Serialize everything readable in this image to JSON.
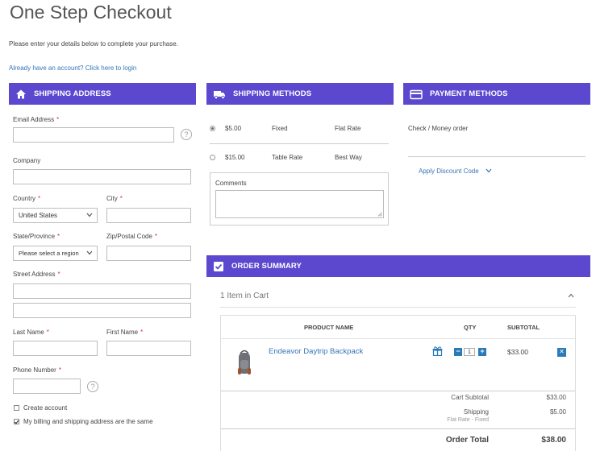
{
  "page": {
    "title": "One Step Checkout",
    "intro": "Please enter your details below to complete your purchase.",
    "login_link": "Already have an account? Click here to login"
  },
  "colors": {
    "header_bg": "#5c48cf",
    "link": "#3577b8",
    "button_blue": "#2a7ab8"
  },
  "shipping_address": {
    "title": "SHIPPING ADDRESS",
    "icon": "home-icon",
    "email_label": "Email Address",
    "company_label": "Company",
    "country_label": "Country",
    "country_value": "United States",
    "city_label": "City",
    "state_label": "State/Province",
    "state_value": "Please select a region",
    "zip_label": "Zip/Postal Code",
    "street_label": "Street Address",
    "last_name_label": "Last Name",
    "first_name_label": "First Name",
    "phone_label": "Phone Number",
    "required_mark": "*",
    "help_mark": "?",
    "create_account_label": "Create account",
    "same_address_label": "My billing and shipping address are the same",
    "create_account_checked": false,
    "same_address_checked": true
  },
  "shipping_methods": {
    "title": "SHIPPING METHODS",
    "icon": "truck-icon",
    "options": [
      {
        "price": "$5.00",
        "carrier": "Fixed",
        "method": "Flat Rate",
        "selected": true
      },
      {
        "price": "$15.00",
        "carrier": "Table Rate",
        "method": "Best Way",
        "selected": false
      }
    ],
    "comments_label": "Comments"
  },
  "payment_methods": {
    "title": "PAYMENT METHODS",
    "icon": "credit-card-icon",
    "method": "Check / Money order",
    "discount_label": "Apply Discount Code"
  },
  "order_summary": {
    "title": "ORDER SUMMARY",
    "icon": "check-square-icon",
    "items_in_cart": "1 Item in Cart",
    "columns": {
      "product": "PRODUCT NAME",
      "qty": "QTY",
      "subtotal": "SUBTOTAL"
    },
    "items": [
      {
        "name": "Endeavor Daytrip Backpack",
        "qty": "1",
        "subtotal": "$33.00"
      }
    ],
    "cart_subtotal_label": "Cart Subtotal",
    "cart_subtotal_value": "$33.00",
    "shipping_label": "Shipping",
    "shipping_detail": "Flat Rate - Fixed",
    "shipping_value": "$5.00",
    "order_total_label": "Order Total",
    "order_total_value": "$38.00"
  }
}
